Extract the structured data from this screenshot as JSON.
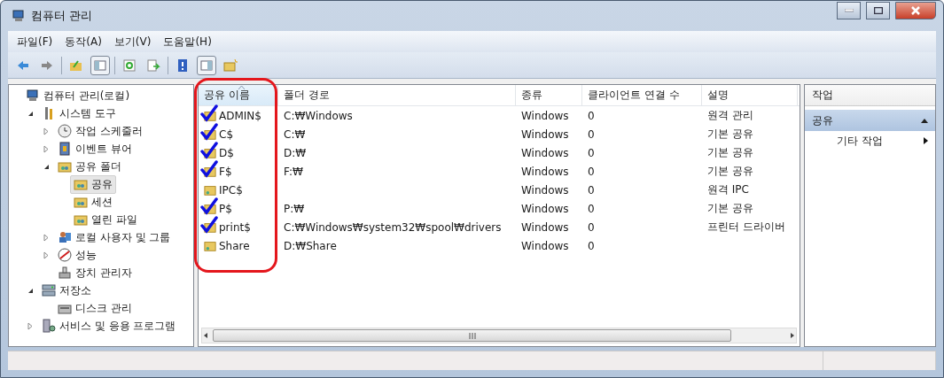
{
  "window": {
    "title": "컴퓨터 관리"
  },
  "menu": [
    "파일(F)",
    "동작(A)",
    "보기(V)",
    "도움말(H)"
  ],
  "toolbar": [
    {
      "kind": "back"
    },
    {
      "kind": "forward"
    },
    {
      "kind": "sep"
    },
    {
      "kind": "up"
    },
    {
      "kind": "tree"
    },
    {
      "kind": "sep"
    },
    {
      "kind": "refresh"
    },
    {
      "kind": "export"
    },
    {
      "kind": "sep"
    },
    {
      "kind": "help"
    },
    {
      "kind": "pane"
    },
    {
      "kind": "newshare"
    }
  ],
  "tree": [
    {
      "label": "컴퓨터 관리(로컬)",
      "kind": "computer",
      "selected": false,
      "children": [
        {
          "label": "시스템 도구",
          "kind": "tools",
          "expanded": true,
          "selected": false,
          "children": [
            {
              "label": "작업 스케줄러",
              "kind": "clock",
              "expanded": false,
              "selected": false
            },
            {
              "label": "이벤트 뷰어",
              "kind": "event",
              "expanded": false,
              "selected": false
            },
            {
              "label": "공유 폴더",
              "kind": "share",
              "expanded": true,
              "selected": false,
              "children": [
                {
                  "label": "공유",
                  "kind": "share",
                  "selected": true
                },
                {
                  "label": "세션",
                  "kind": "share",
                  "selected": false
                },
                {
                  "label": "열린 파일",
                  "kind": "share",
                  "selected": false
                }
              ]
            },
            {
              "label": "로컬 사용자 및 그룹",
              "kind": "users",
              "expanded": false,
              "selected": false
            },
            {
              "label": "성능",
              "kind": "performance",
              "expanded": false,
              "selected": false
            },
            {
              "label": "장치 관리자",
              "kind": "device",
              "selected": false
            }
          ]
        },
        {
          "label": "저장소",
          "kind": "storage",
          "expanded": true,
          "selected": false,
          "children": [
            {
              "label": "디스크 관리",
              "kind": "disk",
              "selected": false
            }
          ]
        },
        {
          "label": "서비스 및 응용 프로그램",
          "kind": "services",
          "expanded": false,
          "selected": false
        }
      ]
    }
  ],
  "table": {
    "outlined": true,
    "columns": [
      {
        "label": "공유 이름",
        "sorted": true
      },
      {
        "label": "폴더 경로",
        "sorted": false
      },
      {
        "label": "종류",
        "sorted": false
      },
      {
        "label": "클라이언트 연결 수",
        "sorted": false
      },
      {
        "label": "설명",
        "sorted": false
      }
    ],
    "rows": [
      {
        "name": "ADMIN$",
        "path": "C:₩Windows",
        "type": "Windows",
        "clients": "0",
        "description": "원격 관리",
        "marked": true
      },
      {
        "name": "C$",
        "path": "C:₩",
        "type": "Windows",
        "clients": "0",
        "description": "기본 공유",
        "marked": true
      },
      {
        "name": "D$",
        "path": "D:₩",
        "type": "Windows",
        "clients": "0",
        "description": "기본 공유",
        "marked": true
      },
      {
        "name": "F$",
        "path": "F:₩",
        "type": "Windows",
        "clients": "0",
        "description": "기본 공유",
        "marked": true
      },
      {
        "name": "IPC$",
        "type": "Windows",
        "clients": "0",
        "description": "원격 IPC",
        "marked": false
      },
      {
        "name": "P$",
        "path": "P:₩",
        "type": "Windows",
        "clients": "0",
        "description": "기본 공유",
        "marked": true
      },
      {
        "name": "print$",
        "path": "C:₩Windows₩system32₩spool₩drivers",
        "type": "Windows",
        "clients": "0",
        "description": "프린터 드라이버",
        "marked": true
      },
      {
        "name": "Share",
        "path": "D:₩Share",
        "type": "Windows",
        "clients": "0",
        "marked": false
      }
    ]
  },
  "actions": {
    "title": "작업",
    "sections": [
      {
        "label": "공유",
        "expanded": true,
        "items": [
          {
            "label": "기타 작업"
          }
        ]
      }
    ]
  }
}
